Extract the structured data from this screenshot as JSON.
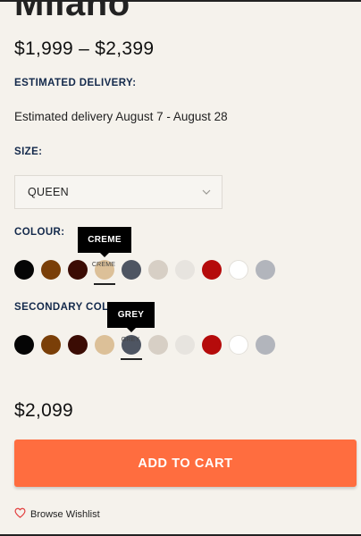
{
  "product": {
    "title": "Milano",
    "price_range": "$1,999 – $2,399",
    "current_price": "$2,099"
  },
  "delivery": {
    "label": "ESTIMATED DELIVERY:",
    "text": "Estimated delivery August 7 - August 28"
  },
  "size": {
    "label": "SIZE:",
    "selected": "QUEEN"
  },
  "colour": {
    "label": "COLOUR:",
    "tooltip": "CREME",
    "selected_caption": "CREME",
    "swatches": [
      "#050505",
      "#7a3f08",
      "#3b0c04",
      "#dcc098",
      "#4e5562",
      "#d7cfc5",
      "#e7e4df",
      "#b50b0b",
      "#ffffff",
      "#b2b5bc"
    ]
  },
  "secondary_colour": {
    "label": "SECONDARY COLOUR:",
    "tooltip": "GREY",
    "selected_caption": "GREY",
    "swatches": [
      "#050505",
      "#7a3f08",
      "#3b0c04",
      "#dcc098",
      "#4e5562",
      "#d7cfc5",
      "#e7e4df",
      "#b50b0b",
      "#ffffff",
      "#b2b5bc"
    ]
  },
  "cart": {
    "button_label": "ADD TO CART"
  },
  "wishlist": {
    "label": "Browse Wishlist",
    "icon": "heart-icon",
    "icon_color": "#e23b3b"
  },
  "colors": {
    "accent": "#ff6d3f",
    "label_navy": "#13294b",
    "background": "#f5f2ec"
  }
}
